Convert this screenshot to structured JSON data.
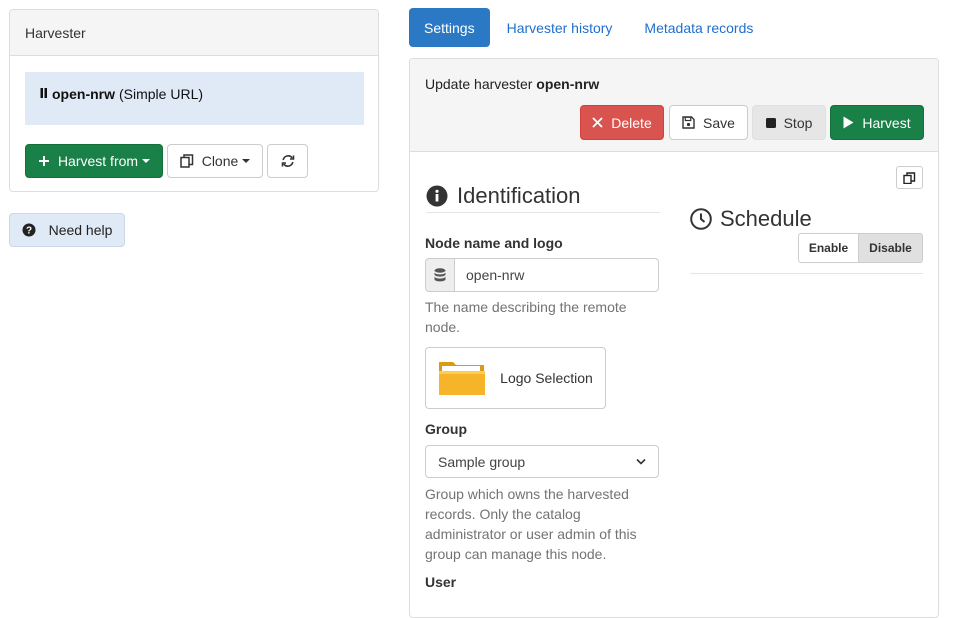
{
  "sidebar": {
    "panel_title": "Harvester",
    "harvester": {
      "name": "open-nrw",
      "type": "(Simple URL)"
    },
    "harvest_from_label": "Harvest from",
    "clone_label": "Clone",
    "refresh_icon": "refresh-icon"
  },
  "help": {
    "label": "Need help"
  },
  "tabs": [
    {
      "label": "Settings",
      "active": true
    },
    {
      "label": "Harvester history",
      "active": false
    },
    {
      "label": "Metadata records",
      "active": false
    }
  ],
  "main": {
    "update_prefix": "Update harvester",
    "harvester_name": "open-nrw",
    "toolbar": {
      "delete_label": "Delete",
      "save_label": "Save",
      "stop_label": "Stop",
      "harvest_label": "Harvest"
    },
    "identification": {
      "title": "Identification",
      "node_label": "Node name and logo",
      "node_value": "open-nrw",
      "node_help": "The name describing the remote node.",
      "logo_label": "Logo Selection",
      "group_label": "Group",
      "group_value": "Sample group",
      "group_help": "Group which owns the harvested records. Only the catalog administrator or user admin of this group can manage this node.",
      "user_label": "User"
    },
    "schedule": {
      "title": "Schedule",
      "enable_label": "Enable",
      "disable_label": "Disable",
      "selected": "Disable"
    }
  },
  "colors": {
    "primary": "#2b78c4",
    "success": "#198047",
    "danger": "#d9534f",
    "link": "#1f6fcf",
    "highlight": "#dfeaf6"
  }
}
